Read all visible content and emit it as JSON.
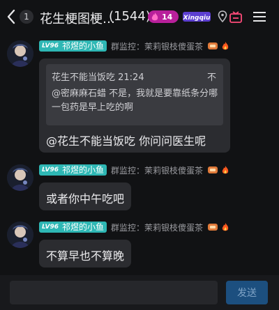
{
  "header": {
    "unread_count": "1",
    "title": "花生梗图梗…",
    "member_count": "(1544)",
    "fire_level": "14",
    "game_logo_text": "Xingqiu"
  },
  "messages": [
    {
      "level": "LV96",
      "nickname": "祁煜的小鱼",
      "role": "群监控：茉莉银枝傻蛋茶",
      "quote": {
        "head": "花生不能当饭吃 21:24",
        "mark": "不",
        "body": "@密麻麻石蜡 不是，我就是要靠纸条分哪一包药是早上吃的啊"
      },
      "text": "@花生不能当饭吃 你问问医生呢"
    },
    {
      "level": "LV96",
      "nickname": "祁煜的小鱼",
      "role": "群监控：茉莉银枝傻蛋茶",
      "text": "或者你中午吃吧"
    },
    {
      "level": "LV96",
      "nickname": "祁煜的小鱼",
      "role": "群监控：茉莉银枝傻蛋茶",
      "text": "不算早也不算晚"
    }
  ],
  "input": {
    "value": "",
    "placeholder": ""
  },
  "send_label": "发送",
  "colors": {
    "background": "#111214",
    "bubble": "#2b2c30",
    "level_badge": "#2eb7b4",
    "fire_badge": "#b8209b",
    "send_button": "#1c4f7f"
  },
  "icons": [
    "back-icon",
    "flame-icon",
    "game-logo",
    "pin-icon",
    "gift-icon",
    "menu-icon",
    "flame-icon",
    "badge-icon"
  ]
}
